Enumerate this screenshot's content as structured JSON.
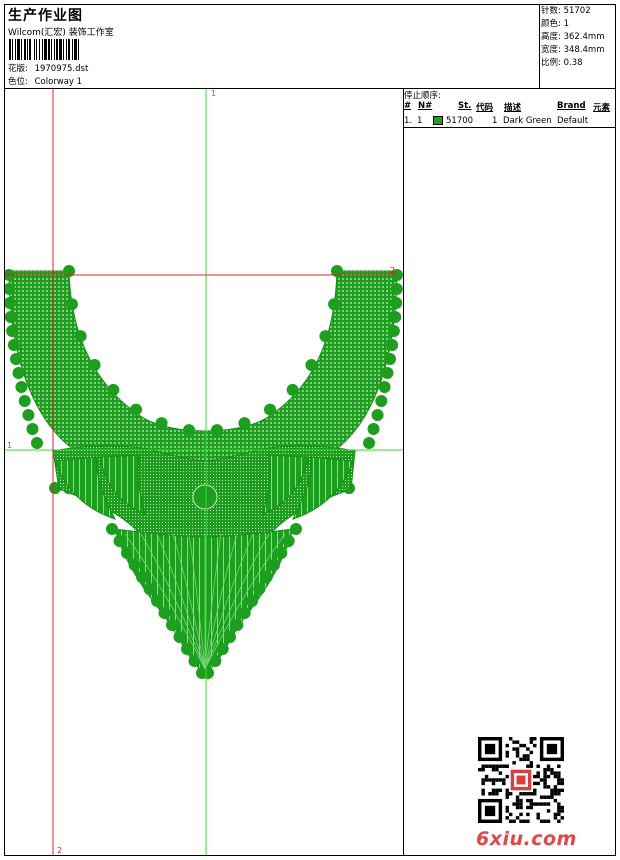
{
  "header": {
    "title": "生产作业图",
    "company": "Wilcom(汇宏) 装饰工作室",
    "design_label": "花版:",
    "design_value": "1970975.dst",
    "colorway_label": "色位:",
    "colorway_value": "Colorway 1"
  },
  "stats": {
    "stitches_label": "针数:",
    "stitches_value": "51702",
    "colors_label": "颜色:",
    "colors_value": "1",
    "height_label": "高度:",
    "height_value": "362.4mm",
    "width_label": "宽度:",
    "width_value": "348.4mm",
    "scale_label": "比例:",
    "scale_value": "0.38"
  },
  "stop_sequence": {
    "title": "停止顺序:",
    "columns": [
      "#",
      "N#",
      "St.",
      "代码",
      "描述",
      "Brand",
      "元素"
    ],
    "rows": [
      {
        "num": "1.",
        "needle": "1",
        "stitches": "51700",
        "code": "1",
        "description": "Dark Green",
        "brand": "Default",
        "color": "#22a022"
      }
    ]
  },
  "guides": {
    "top_label": "1",
    "left_label": "1",
    "right_label": "2",
    "bottom_label": "2"
  },
  "design_colors": {
    "fill": "#1e9e1e",
    "guide_green": "#33dd33",
    "guide_red": "#e02020"
  },
  "watermark": "6xiu.com",
  "qr_icon": "qr-code-icon"
}
